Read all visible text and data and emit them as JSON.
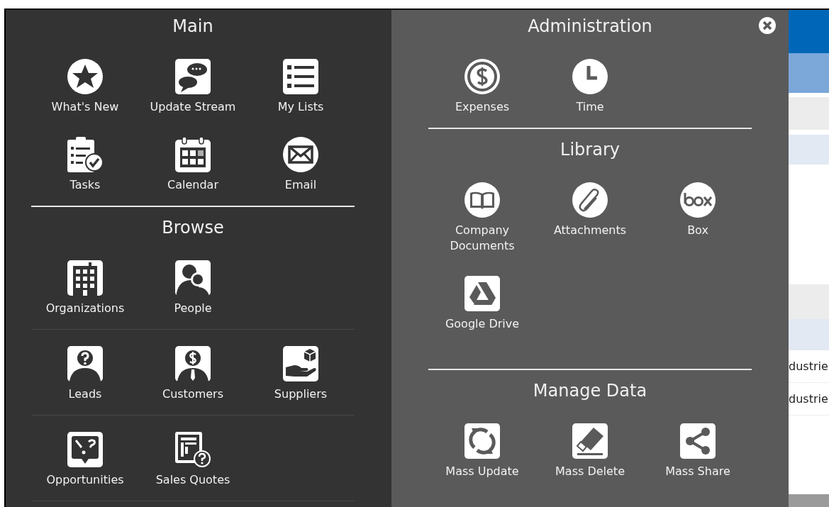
{
  "menu": {
    "columns": [
      {
        "sections": [
          {
            "title": "Main",
            "row_lines": false,
            "rows": [
              [
                "What's New",
                "Update Stream",
                "My Lists"
              ],
              [
                "Tasks",
                "Calendar",
                "Email"
              ]
            ]
          },
          {
            "title": "Browse",
            "row_lines": true,
            "rows": [
              [
                "Organizations",
                "People"
              ],
              [
                "Leads",
                "Customers",
                "Suppliers"
              ],
              [
                "Opportunities",
                "Sales Quotes"
              ]
            ]
          }
        ]
      },
      {
        "sections": [
          {
            "title": "Administration",
            "row_lines": false,
            "rows": [
              [
                "Expenses",
                "Time"
              ]
            ]
          },
          {
            "title": "Library",
            "row_lines": false,
            "rows": [
              [
                "Company Documents",
                "Attachments",
                "Box"
              ],
              [
                "Google Drive"
              ]
            ]
          },
          {
            "title": "Manage Data",
            "row_lines": false,
            "rows": [
              [
                "Mass Update",
                "Mass Delete",
                "Mass Share"
              ]
            ]
          }
        ]
      }
    ]
  },
  "background": {
    "cells": [
      "dustrie",
      "dustrie"
    ]
  }
}
